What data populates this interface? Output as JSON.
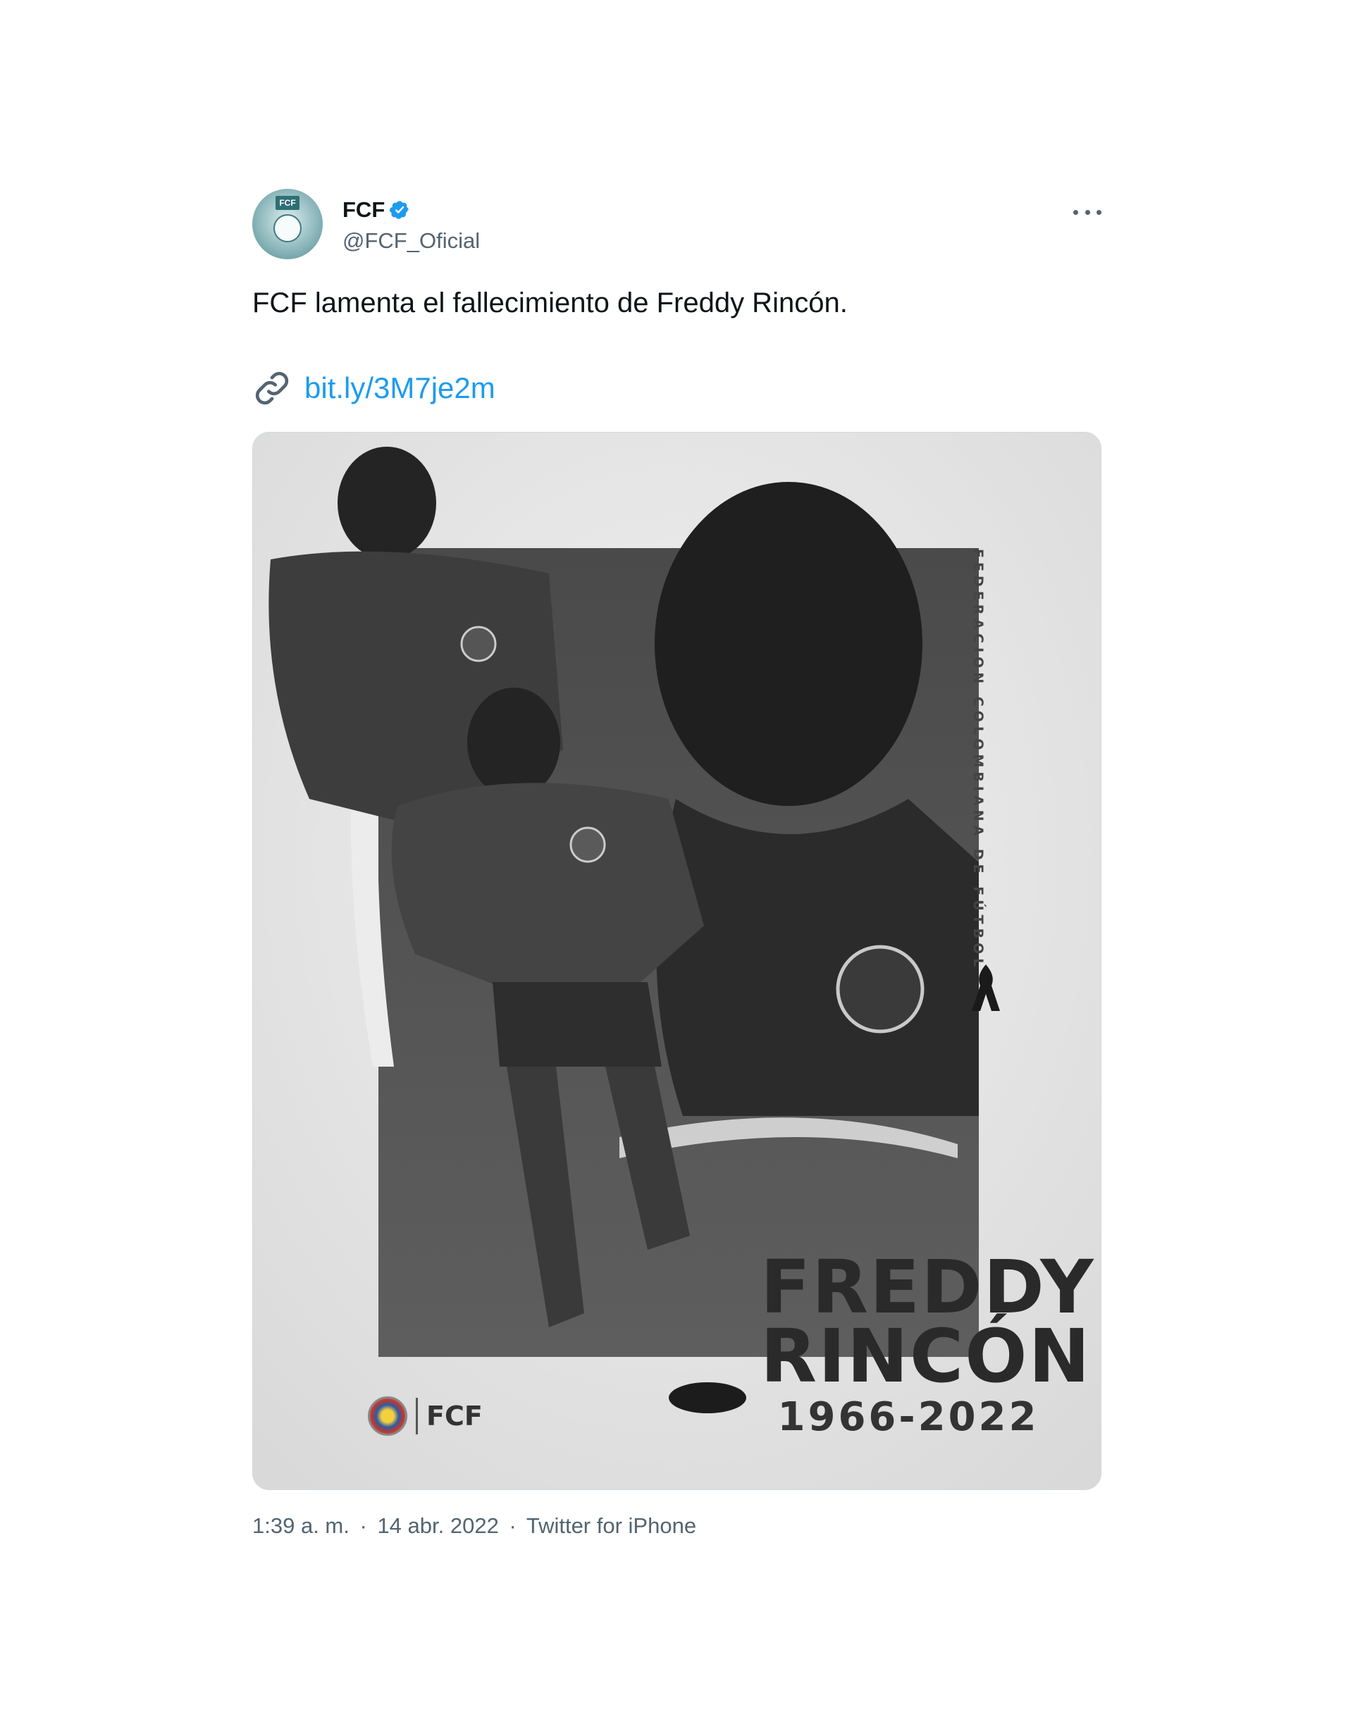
{
  "tweet": {
    "display_name": "FCF",
    "handle": "@FCF_Oficial",
    "text": "FCF lamenta el fallecimiento de Freddy Rincón.",
    "link": "bit.ly/3M7je2m",
    "time": "1:39 a. m.",
    "date": "14 abr. 2022",
    "source": "Twitter for iPhone",
    "separator": "·"
  },
  "poster": {
    "first_name": "FREDDY",
    "last_name": "RINCÓN",
    "years": "1966-2022",
    "vertical_text": "FEDERACION COLOMBIANA DE FÚTBOL",
    "logo_text": "FCF"
  },
  "icons": [
    "verified-badge-icon",
    "more-options-icon",
    "link-icon",
    "mourning-ribbon-icon",
    "fcf-crest-icon"
  ],
  "colors": {
    "link": "#1d9bf0",
    "verified": "#1d9bf0",
    "secondary_text": "#536471",
    "primary_text": "#0f1419"
  }
}
